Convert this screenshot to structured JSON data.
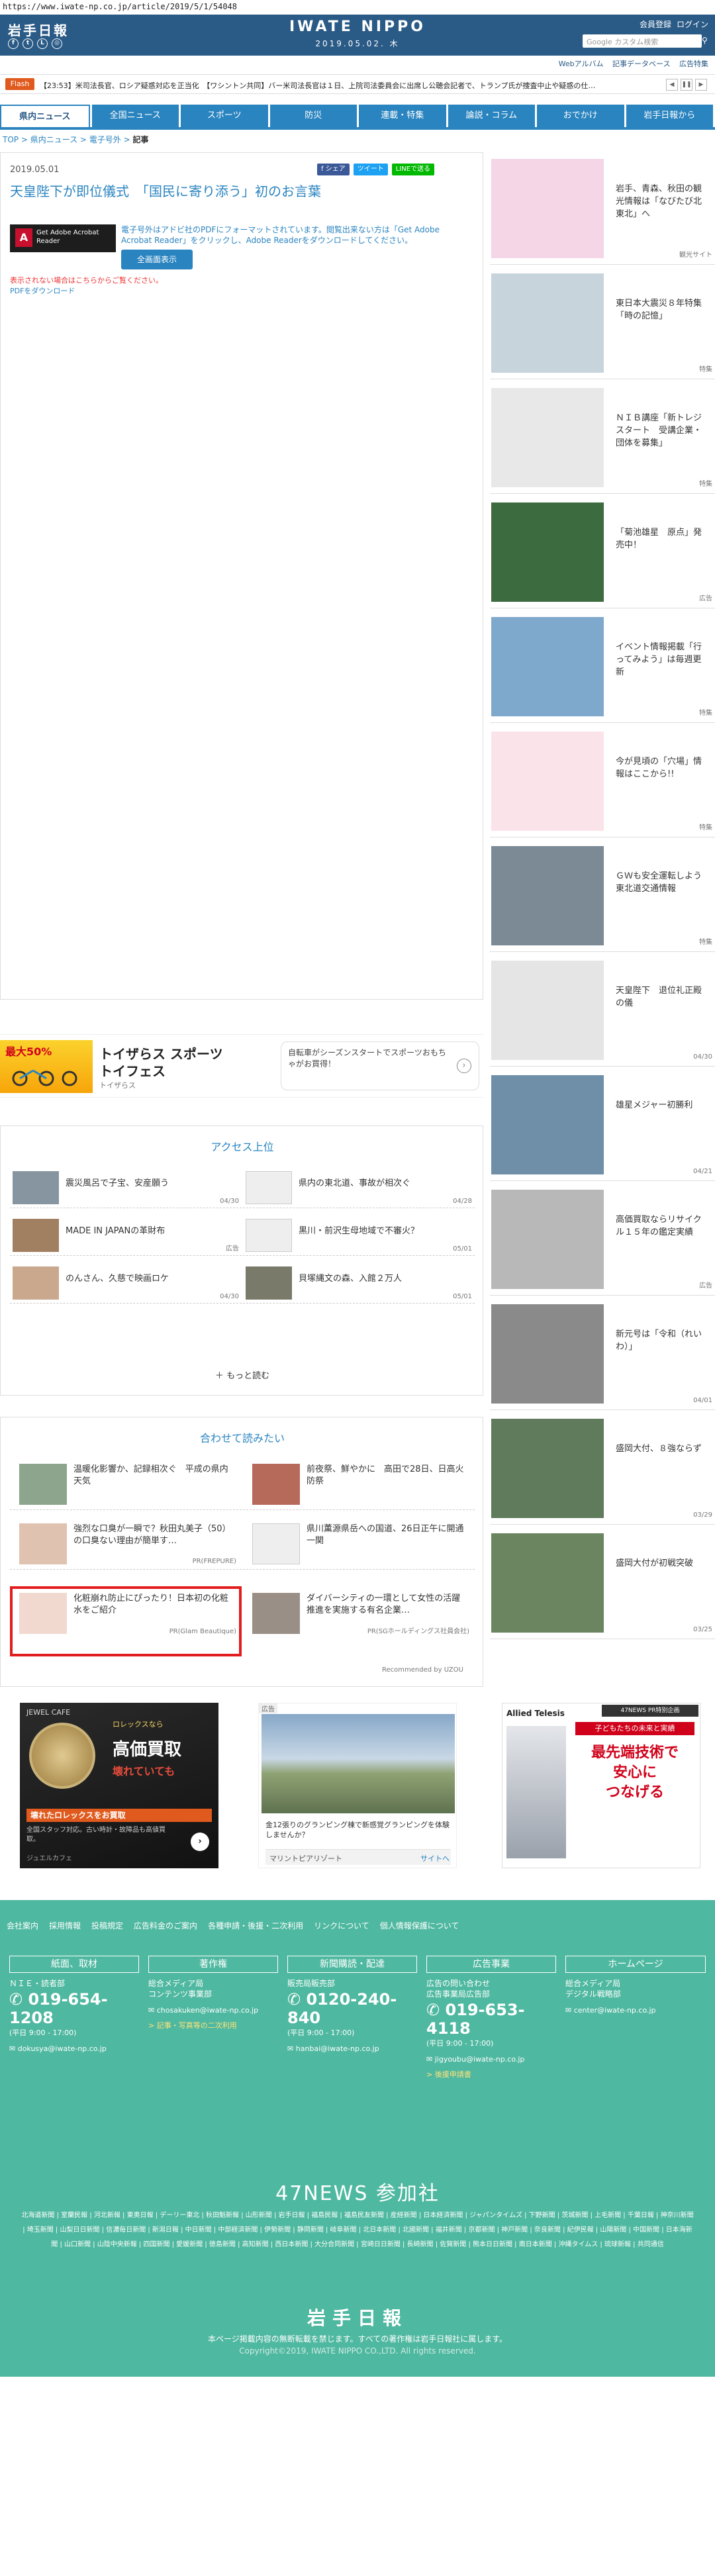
{
  "url": "https://www.iwate-np.co.jp/article/2019/5/1/54048",
  "header": {
    "logo": "岩手日報",
    "brand": "IWATE NIPPO",
    "date": "2019.05.02. 木",
    "links": [
      "会員登録",
      "ログイン"
    ],
    "search_placeholder": "Google カスタム検索",
    "subbar": [
      "Webアルバム",
      "記事データベース",
      "広告特集"
    ]
  },
  "flash": {
    "badge": "Flash",
    "text": "【23:53】米司法長官、ロシア疑惑対応を正当化　【ワシントン共同】バー米司法長官は１日、上院司法委員会に出席し公聴会記者で、トランプ氏が捜査中止や疑惑の仕…"
  },
  "nav": [
    "県内ニュース",
    "全国ニュース",
    "スポーツ",
    "防災",
    "連載・特集",
    "論説・コラム",
    "おでかけ",
    "岩手日報から"
  ],
  "breadcrumb": {
    "items": [
      "TOP",
      "県内ニュース",
      "電子号外"
    ],
    "current": "記事"
  },
  "article": {
    "date": "2019.05.01",
    "share": [
      "f シェア",
      "ツイート",
      "LINEで送る"
    ],
    "title": "天皇陛下が即位儀式　「国民に寄り添う」初のお言葉",
    "adobe": "Get Adobe Acrobat Reader",
    "pdf_note": "電子号外はアドビ社のPDFにフォーマットされています。閲覧出来ない方は「Get Adobe Acrobat Reader」をクリックし、Adobe Readerをダウンロードしてください。",
    "fullscreen": "全画面表示",
    "warn": "表示されない場合はこちらからご覧ください。",
    "download": "PDFをダウンロード"
  },
  "ad_toys": {
    "title": "トイザらス スポーツ\nトイフェス",
    "sub": "トイザらス",
    "box": "自転車がシーズンスタートでスポーツおもちゃがお買得！",
    "badge": "最大50%"
  },
  "ranking": {
    "title": "アクセス上位",
    "items": [
      {
        "text": "震災風呂で子宝、安産願う",
        "date": "04/30"
      },
      {
        "text": "県内の東北道、事故が相次ぐ",
        "date": "04/28"
      },
      {
        "text": "MADE IN JAPANの革財布",
        "date": "広告"
      },
      {
        "text": "黒川・前沢生母地域で不審火？",
        "date": "05/01"
      },
      {
        "text": "のんさん、久慈で映画ロケ",
        "date": "04/30"
      },
      {
        "text": "貝塚縄文の森、入館２万人",
        "date": "05/01"
      }
    ],
    "more": "もっと読む"
  },
  "related": {
    "title": "合わせて読みたい",
    "items": [
      {
        "text": "温暖化影響か、記録相次ぐ　平成の県内天気",
        "pr": ""
      },
      {
        "text": "前夜祭、鮮やかに　高田で28日、日高火防祭",
        "pr": ""
      },
      {
        "text": "強烈な口臭が一瞬で？秋田丸美子（50）の口臭ない理由が簡単す…",
        "pr": "PR(FREPURE)"
      },
      {
        "text": "県川薫源県岳への国道、26日正午に開通　一関",
        "pr": ""
      },
      {
        "text": "化粧崩れ防止にぴったり！日本初の化粧水をご紹介",
        "pr": "PR(Glam Beautique)"
      },
      {
        "text": "ダイバーシティの一環として女性の活躍推進を実施する有名企業…",
        "pr": "PR(SGホールディングス社員会社)"
      }
    ],
    "credit": "Recommended by UZOU"
  },
  "ads_bottom": {
    "rolex_brand": "JEWEL CAFE",
    "rolex_headline": "高価買取",
    "rolex_vertical": "壊れていても",
    "rolex_sub": "ロレックスなら",
    "rolex_bar": "壊れたロレックスをお買取",
    "rolex_small": "全国スタッフ対応。古い時計・故障品も高値買取。",
    "rolex_footer": "ジュエルカフェ",
    "glamp_label": "広告",
    "glamp_text": "金12張りのグランピング棟で新感覚グランピングを体験しませんか？",
    "glamp_brand": "マリントピアリゾート",
    "glamp_site": "サイトへ",
    "allied_brand": "Allied Telesis",
    "allied_tag": "子どもたちの未来と実績",
    "allied_headline": "最先端技術で\n安心に\nつなげる",
    "allied_label": "47NEWS PR特別企画"
  },
  "sidebar": [
    {
      "text": "岩手、青森、秋田の観光情報は「なびたび北東北」へ",
      "tag": "観光サイト",
      "color": "#f5d6e7"
    },
    {
      "text": "東日本大震災８年特集「時の記憶」",
      "tag": "特集",
      "color": "#c8d4dc"
    },
    {
      "text": "ＮＩＢ講座「新トレジスタート　受講企業・団体を募集」",
      "tag": "特集",
      "color": "#e8e8e8"
    },
    {
      "text": "「菊池雄星　原点」発売中！",
      "tag": "広告",
      "color": "#3b6b3f"
    },
    {
      "text": "イベント情報掲載「行ってみよう」は毎週更新",
      "tag": "特集",
      "color": "#7fa9cc"
    },
    {
      "text": "今が見頃の「穴場」情報はここから!!",
      "tag": "特集",
      "color": "#fbe3ea"
    },
    {
      "text": "ＧＷも安全運転しよう　東北道交通情報",
      "tag": "特集",
      "color": "#7c8a96"
    },
    {
      "text": "天皇陛下　退位礼正殿の儀",
      "tag": "04/30",
      "color": "#e5e5e5"
    },
    {
      "text": "雄星メジャー初勝利",
      "tag": "04/21",
      "color": "#6f8fa8"
    },
    {
      "text": "高価買取ならリサイクル１５年の鑑定実績",
      "tag": "広告",
      "color": "#b8b8b8"
    },
    {
      "text": "新元号は「令和（れいわ）」",
      "tag": "04/01",
      "color": "#8a8a8a"
    },
    {
      "text": "盛岡大付、８強ならず",
      "tag": "03/29",
      "color": "#607a5c"
    },
    {
      "text": "盛岡大付が初戦突破",
      "tag": "03/25",
      "color": "#6a8560"
    }
  ],
  "footer": {
    "links": [
      "会社案内",
      "採用情報",
      "投稿規定",
      "広告料金のご案内",
      "各種申請・後援・二次利用",
      "リンクについて",
      "個人情報保護について"
    ],
    "cols": [
      {
        "head": "紙面、取材",
        "sub": "ＮＩＥ・読者部",
        "phone": "019-654-1208",
        "hours": "(平日 9:00 - 17:00)",
        "mail": "dokusya@iwate-np.co.jp",
        "link": ""
      },
      {
        "head": "著作権",
        "sub": "総合メディア局\nコンテンツ事業部",
        "phone": "",
        "hours": "",
        "mail": "chosakuken@iwate-np.co.jp",
        "link": "記事・写真等の二次利用"
      },
      {
        "head": "新聞購読・配達",
        "sub": "販売局販売部",
        "phone": "0120-240-840",
        "hours": "(平日 9:00 - 17:00)",
        "mail": "hanbai@iwate-np.co.jp",
        "link": ""
      },
      {
        "head": "広告事業",
        "sub": "広告の問い合わせ\n広告事業局広告部",
        "phone": "019-653-4118",
        "hours": "(平日 9:00 - 17:00)",
        "mail": "jigyoubu@iwate-np.co.jp",
        "link": "後援申請書"
      },
      {
        "head": "ホームページ",
        "sub": "総合メディア局\nデジタル戦略部",
        "phone": "",
        "hours": "",
        "mail": "center@iwate-np.co.jp",
        "link": ""
      }
    ],
    "news47": "47NEWS 参加社",
    "news47_list": "北海道新聞 | 室蘭民報 | 河北新報 | 東奥日報 | デーリー東北 | 秋田魁新報 | 山形新聞 | 岩手日報 | 福島民報 | 福島民友新聞 | 産経新聞 | 日本経済新聞 | ジャパンタイムズ | 下野新聞 | 茨城新聞 | 上毛新聞 | 千葉日報 | 神奈川新聞 | 埼玉新聞 | 山梨日日新聞 | 信濃毎日新聞 | 新潟日報 | 中日新聞 | 中部経済新聞 | 伊勢新聞 | 静岡新聞 | 岐阜新聞 | 北日本新聞 | 北國新聞 | 福井新聞 | 京都新聞 | 神戸新聞 | 奈良新聞 | 紀伊民報 | 山陽新聞 | 中国新聞 | 日本海新聞 | 山口新聞 | 山陰中央新報 | 四国新聞 | 愛媛新聞 | 徳島新聞 | 高知新聞 | 西日本新聞 | 大分合同新聞 | 宮崎日日新聞 | 長崎新聞 | 佐賀新聞 | 熊本日日新聞 | 南日本新聞 | 沖縄タイムス | 琉球新報 | 共同通信",
    "logo": "岩手日報",
    "copy1": "本ページ掲載内容の無断転載を禁じます。すべての著作権は岩手日報社に属します。",
    "copy2": "Copyright©2019, IWATE NIPPO CO.,LTD. All rights reserved."
  }
}
